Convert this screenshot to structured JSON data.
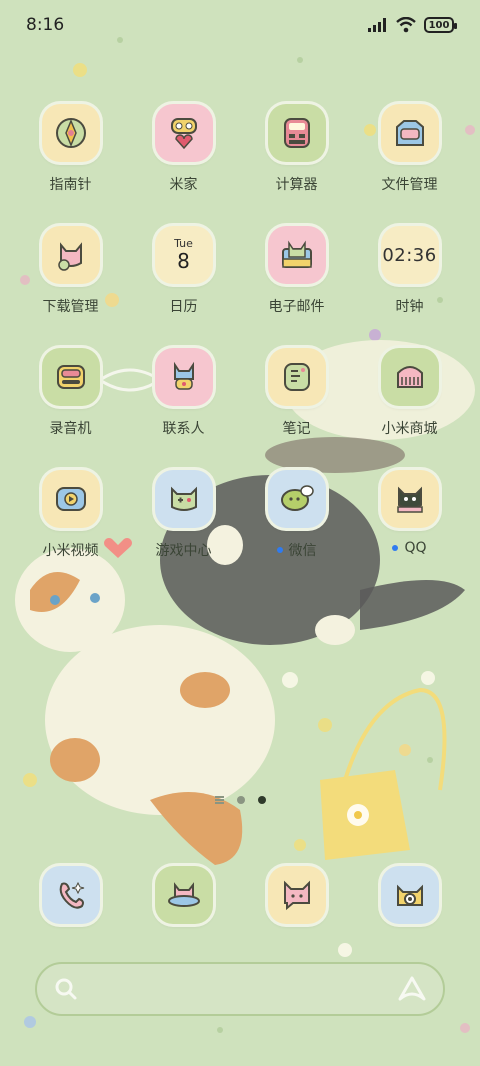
{
  "status": {
    "time": "8:16",
    "battery": "100"
  },
  "apps": [
    {
      "label": "指南针",
      "icon": "compass-icon",
      "bg": "#f7e7b6"
    },
    {
      "label": "米家",
      "icon": "mijia-icon",
      "bg": "#f6c6cf"
    },
    {
      "label": "计算器",
      "icon": "calculator-icon",
      "bg": "#c9dda5"
    },
    {
      "label": "文件管理",
      "icon": "file-manager-icon",
      "bg": "#f7e7b6"
    },
    {
      "label": "下载管理",
      "icon": "download-icon",
      "bg": "#f7e7b6"
    },
    {
      "label": "日历",
      "icon": "calendar-icon",
      "bg": "#f7ecc4",
      "day": "Tue",
      "date": "8"
    },
    {
      "label": "电子邮件",
      "icon": "email-icon",
      "bg": "#f6c6cf"
    },
    {
      "label": "时钟",
      "icon": "clock-icon",
      "bg": "#f7ecc4",
      "time": "02:36"
    },
    {
      "label": "录音机",
      "icon": "recorder-icon",
      "bg": "#c9dda5"
    },
    {
      "label": "联系人",
      "icon": "contacts-icon",
      "bg": "#f6c6cf"
    },
    {
      "label": "笔记",
      "icon": "notes-icon",
      "bg": "#f7e7b6"
    },
    {
      "label": "小米商城",
      "icon": "mi-store-icon",
      "bg": "#c9dda5"
    },
    {
      "label": "小米视频",
      "icon": "mi-video-icon",
      "bg": "#f7e7b6"
    },
    {
      "label": "游戏中心",
      "icon": "game-center-icon",
      "bg": "#cde0ef"
    },
    {
      "label": "微信",
      "icon": "wechat-icon",
      "bg": "#cde0ef"
    },
    {
      "label": "QQ",
      "icon": "qq-icon",
      "bg": "#f7e7b6"
    }
  ],
  "dock": [
    {
      "icon": "phone-icon",
      "bg": "#cde0ef"
    },
    {
      "icon": "browser-icon",
      "bg": "#c9dda5"
    },
    {
      "icon": "messages-icon",
      "bg": "#f7e7b6"
    },
    {
      "icon": "camera-icon",
      "bg": "#cde0ef"
    }
  ],
  "search": {
    "left_icon": "search-icon",
    "right_icon": "assistant-icon"
  }
}
